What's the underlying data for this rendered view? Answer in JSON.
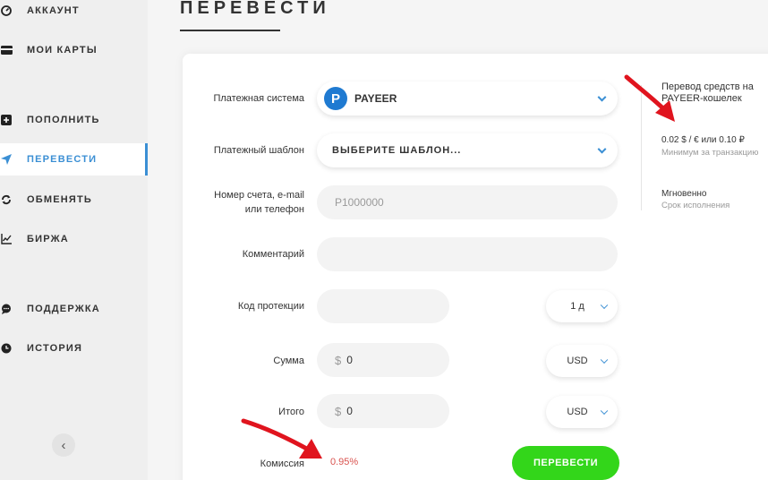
{
  "sidebar": {
    "items": [
      {
        "label": "АККАУНТ",
        "icon": "dashboard-icon"
      },
      {
        "label": "МОИ КАРТЫ",
        "icon": "card-icon"
      },
      {
        "label": "ПОПОЛНИТЬ",
        "icon": "plus-icon"
      },
      {
        "label": "ПЕРЕВЕСТИ",
        "icon": "send-icon"
      },
      {
        "label": "ОБМЕНЯТЬ",
        "icon": "exchange-icon"
      },
      {
        "label": "БИРЖА",
        "icon": "chart-icon"
      },
      {
        "label": "ПОДДЕРЖКА",
        "icon": "chat-icon"
      },
      {
        "label": "ИСТОРИЯ",
        "icon": "clock-icon"
      }
    ],
    "active_item": "ПЕРЕВЕСТИ",
    "collapse_glyph": "‹"
  },
  "page": {
    "title": "ПЕРЕВЕСТИ"
  },
  "form": {
    "payment_system": {
      "label": "Платежная система",
      "value": "PAYEER",
      "logo_letter": "P"
    },
    "template": {
      "label": "Платежный шаблон",
      "value": "ВЫБЕРИТЕ ШАБЛОН..."
    },
    "account": {
      "label_line1": "Номер счета, e-mail",
      "label_line2": "или телефон",
      "placeholder": "P1000000"
    },
    "comment": {
      "label": "Комментарий",
      "value": ""
    },
    "protection": {
      "label": "Код протекции",
      "value": "",
      "period": "1 д"
    },
    "amount": {
      "label": "Сумма",
      "currency_symbol": "$",
      "value": "0",
      "currency": "USD"
    },
    "total": {
      "label": "Итого",
      "currency_symbol": "$",
      "value": "0",
      "currency": "USD"
    },
    "fee": {
      "label": "Комиссия",
      "value": "0.95%"
    },
    "submit_label": "ПЕРЕВЕСТИ"
  },
  "info": {
    "title": "Перевод средств на PAYEER-кошелек",
    "min_value": "0.02 $ / € или 0.10 ₽",
    "min_caption": "Минимум за транзакцию",
    "time_value": "Мгновенно",
    "time_caption": "Срок исполнения"
  },
  "colors": {
    "accent": "#3b8fd4",
    "submit": "#33d61a",
    "fee": "#d9534f",
    "annotation_arrow": "#e0141e"
  }
}
